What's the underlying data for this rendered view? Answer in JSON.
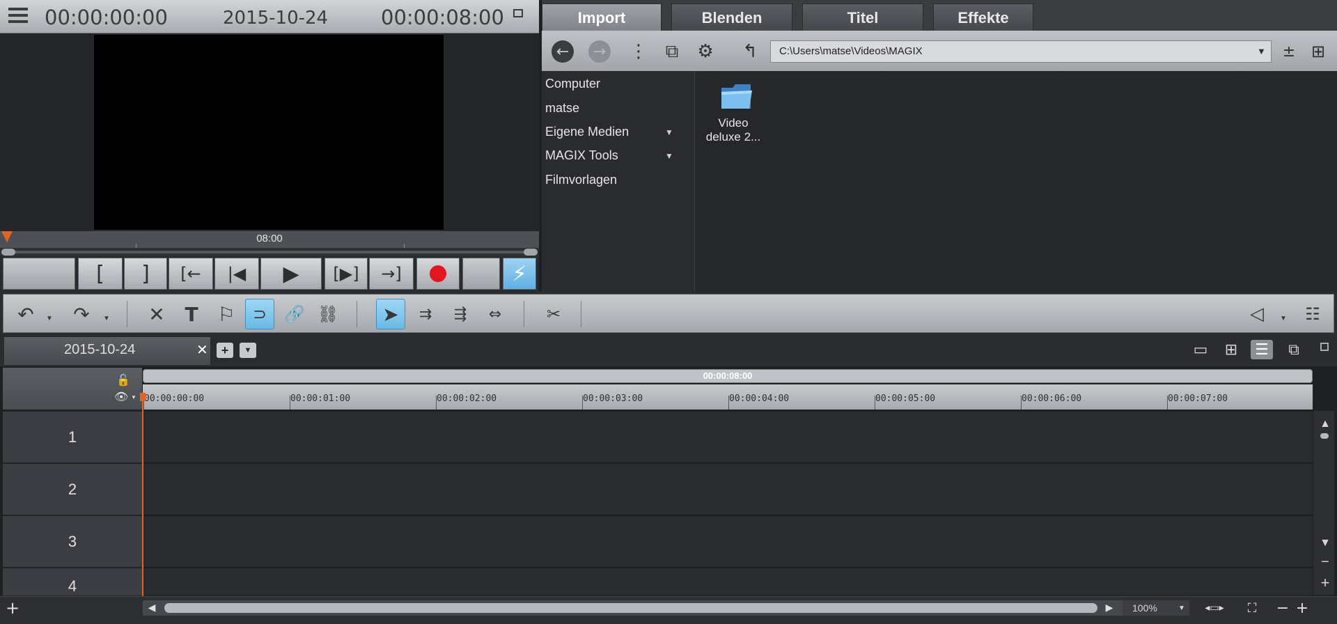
{
  "preview": {
    "timecode_start": "00:00:00:00",
    "project_date": "2015-10-24",
    "timecode_end": "00:00:08:00",
    "scrub_label": "08:00",
    "transport": {
      "mark_in": "[",
      "mark_out": "]",
      "prev_marker": "[←",
      "prev": "|◀",
      "play": "▶",
      "next": "[▶]",
      "next_marker": "→]"
    }
  },
  "media_pool": {
    "tabs": [
      "Import",
      "Blenden",
      "Titel",
      "Effekte"
    ],
    "active_tab": "Import",
    "path": "C:\\Users\\matse\\Videos\\MAGIX",
    "tree": [
      {
        "label": "Computer",
        "has_children": false
      },
      {
        "label": "matse",
        "has_children": false
      },
      {
        "label": "Eigene Medien",
        "has_children": true
      },
      {
        "label": "MAGIX Tools",
        "has_children": true
      },
      {
        "label": "Filmvorlagen",
        "has_children": false
      }
    ],
    "folder": {
      "label_line1": "Video",
      "label_line2": "deluxe 2..."
    }
  },
  "project": {
    "tab_label": "2015-10-24",
    "ruler_duration": "00:00:08:00",
    "ruler_marks": [
      "00:00:00:00",
      "00:00:01:00",
      "00:00:02:00",
      "00:00:03:00",
      "00:00:04:00",
      "00:00:05:00",
      "00:00:06:00",
      "00:00:07:00"
    ],
    "tracks": [
      "1",
      "2",
      "3",
      "4"
    ]
  },
  "bottom": {
    "zoom": "100%"
  },
  "colors": {
    "accent_blue": "#6ab9e6",
    "playhead_orange": "#e2641e",
    "record_red": "#e2161c"
  }
}
